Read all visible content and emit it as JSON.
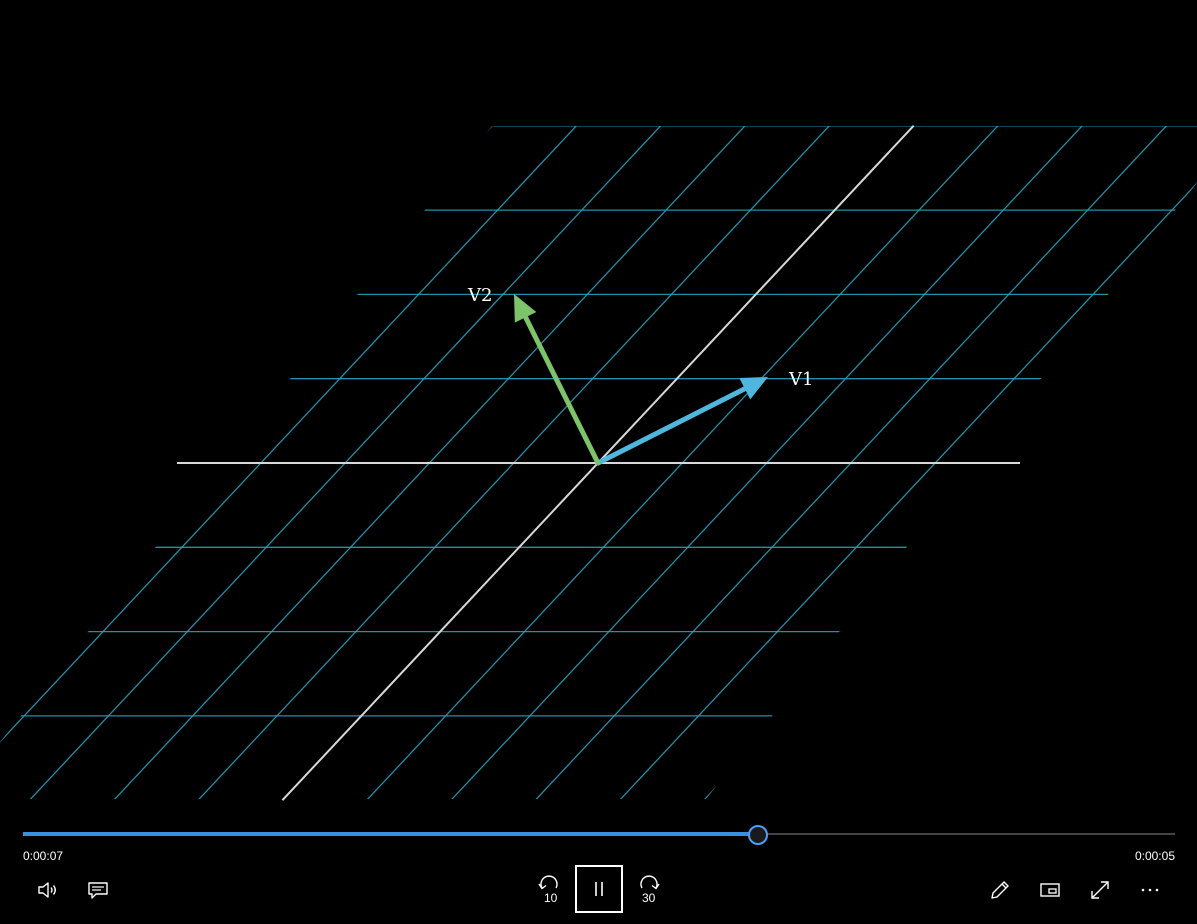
{
  "video": {
    "vector_labels": {
      "v1": "V1",
      "v2": "V2"
    },
    "colors": {
      "grid": "#2aa8c4",
      "axis": "#d8d8d8",
      "v1": "#4fb7dd",
      "v2": "#7cc36a"
    }
  },
  "playback": {
    "elapsed": "0:00:07",
    "remaining": "0:00:05",
    "progress_fraction": 0.637,
    "skip_back_seconds": "10",
    "skip_forward_seconds": "30",
    "state": "playing"
  },
  "controls": {
    "left": [
      "speaker-icon",
      "captions-icon"
    ],
    "center": [
      "skip-back-icon",
      "pause-icon",
      "skip-forward-icon"
    ],
    "right": [
      "pen-icon",
      "mini-view-icon",
      "fullscreen-icon",
      "more-icon"
    ]
  },
  "colors": {
    "background": "#000000",
    "progress_fill": "#3a8fe0",
    "progress_thumb_border": "#4aa0ff",
    "control_icons": "#ffffff"
  }
}
